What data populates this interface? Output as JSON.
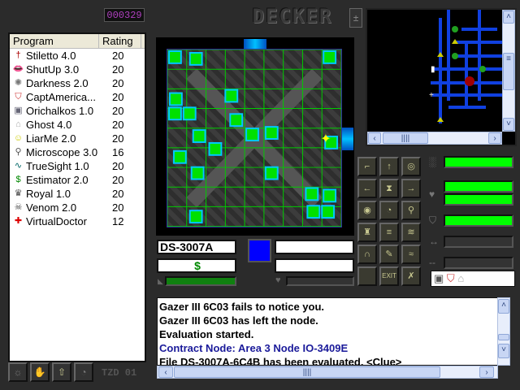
{
  "counter": "000329",
  "logo": "DECKER",
  "zoom_toggle": "±",
  "program_list": {
    "headers": [
      "Program",
      "Rating"
    ],
    "items": [
      {
        "name": "Stiletto 4.0",
        "rating": "20",
        "icon": "dagger-icon",
        "glyph": "†",
        "color": "#a00"
      },
      {
        "name": "ShutUp 3.0",
        "rating": "20",
        "icon": "lips-icon",
        "glyph": "👄",
        "color": "#c33"
      },
      {
        "name": "Darkness 2.0",
        "rating": "20",
        "icon": "cloud-icon",
        "glyph": "✺",
        "color": "#777"
      },
      {
        "name": "CaptAmerica...",
        "rating": "20",
        "icon": "shield-icon",
        "glyph": "⛉",
        "color": "#c33"
      },
      {
        "name": "Orichalkos 1.0",
        "rating": "20",
        "icon": "armor-icon",
        "glyph": "▣",
        "color": "#667"
      },
      {
        "name": "Ghost 4.0",
        "rating": "20",
        "icon": "ghost-icon",
        "glyph": "⌂",
        "color": "#aaa"
      },
      {
        "name": "LiarMe 2.0",
        "rating": "20",
        "icon": "smiley-icon",
        "glyph": "☺",
        "color": "#cc0"
      },
      {
        "name": "Microscope 3.0",
        "rating": "16",
        "icon": "magnifier-icon",
        "glyph": "⚲",
        "color": "#555"
      },
      {
        "name": "TrueSight 1.0",
        "rating": "20",
        "icon": "eyes-icon",
        "glyph": "∿",
        "color": "#066"
      },
      {
        "name": "Estimator 2.0",
        "rating": "20",
        "icon": "dollar-icon",
        "glyph": "$",
        "color": "#080"
      },
      {
        "name": "Royal 1.0",
        "rating": "20",
        "icon": "crown-icon",
        "glyph": "♛",
        "color": "#444"
      },
      {
        "name": "Venom 2.0",
        "rating": "20",
        "icon": "skull-icon",
        "glyph": "☠",
        "color": "#444"
      },
      {
        "name": "VirtualDoctor",
        "rating": "12",
        "icon": "red-cross-icon",
        "glyph": "✚",
        "color": "#d00"
      }
    ]
  },
  "node_panel": {
    "file_name": "DS-3007A",
    "file_icon": "$",
    "file_icon_color": "#080",
    "node_color": "#0000ff",
    "field2": "",
    "field3": "",
    "load_progress": 1.0,
    "health_progress": 0.0
  },
  "action_buttons": [
    {
      "name": "gun-icon",
      "glyph": "⌐"
    },
    {
      "name": "up-arrow-icon",
      "glyph": "↑"
    },
    {
      "name": "target-icon",
      "glyph": "◎"
    },
    {
      "name": "left-pointer-icon",
      "glyph": "←"
    },
    {
      "name": "hourglass-icon",
      "glyph": "⧗"
    },
    {
      "name": "right-arrow-icon",
      "glyph": "→"
    },
    {
      "name": "eye-icon",
      "glyph": "◉"
    },
    {
      "name": "clock-icon",
      "glyph": "◔"
    },
    {
      "name": "search-icon",
      "glyph": "⚲"
    },
    {
      "name": "shirt-icon",
      "glyph": "♜"
    },
    {
      "name": "stack-icon",
      "glyph": "≡"
    },
    {
      "name": "broom-icon",
      "glyph": "≋"
    },
    {
      "name": "magnet-icon",
      "glyph": "∩"
    },
    {
      "name": "pen-icon",
      "glyph": "✎"
    },
    {
      "name": "waves-icon",
      "glyph": "≈"
    },
    {
      "name": "empty-slot",
      "glyph": ""
    },
    {
      "name": "exit-icon",
      "glyph": "EXIT"
    },
    {
      "name": "wrench-icon",
      "glyph": "✗"
    }
  ],
  "status_bars": [
    {
      "icon": "shadow-icon",
      "glyph": "░",
      "values": [
        1.0
      ]
    },
    {
      "icon": "heart-icon",
      "glyph": "♥",
      "values": [
        1.0,
        1.0
      ]
    },
    {
      "icon": "shield-icon",
      "glyph": "⛉",
      "values": [
        1.0
      ]
    },
    {
      "icon": "link-icon",
      "glyph": "↔",
      "values": [
        0.0
      ]
    },
    {
      "icon": "dash-icon",
      "glyph": "--",
      "values": [
        0.0
      ]
    }
  ],
  "active_programs": [
    "armor-icon",
    "shield-icon",
    "ghost-icon"
  ],
  "log": [
    {
      "text": "Gazer III 6C03 fails to notice you.",
      "color": "#000"
    },
    {
      "text": "Gazer III 6C03 has left the node.",
      "color": "#000"
    },
    {
      "text": "Evaluation started.",
      "color": "#000"
    },
    {
      "text": "Contract Node: Area 3 Node IO-3409E",
      "color": "#1a1a9a"
    },
    {
      "text": "File DS-3007A-6C4B has been evaluated. <Clue>",
      "color": "#000"
    }
  ],
  "bottom": {
    "label": "TZD 01"
  },
  "colors": {
    "grid": "#00cc00",
    "file": "#00e000",
    "file_border": "#00c8ff",
    "minimap_line": "#1040e0"
  }
}
